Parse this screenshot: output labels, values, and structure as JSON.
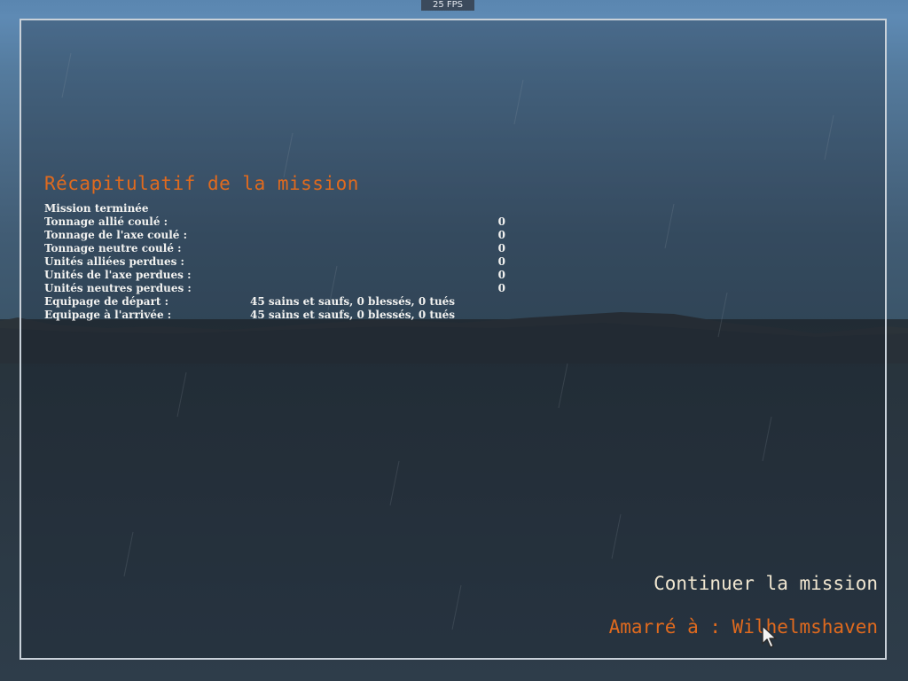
{
  "hud": {
    "fps": "25 FPS"
  },
  "summary": {
    "title": "Récapitulatif de la mission",
    "status": "Mission terminée",
    "rows": [
      {
        "label": "Tonnage allié coulé :",
        "value": "0"
      },
      {
        "label": "Tonnage de l'axe coulé :",
        "value": "0"
      },
      {
        "label": "Tonnage neutre coulé :",
        "value": "0"
      },
      {
        "label": "Unités alliées perdues :",
        "value": "0"
      },
      {
        "label": "Unités de l'axe perdues :",
        "value": "0"
      },
      {
        "label": "Unités neutres perdues :",
        "value": "0"
      }
    ],
    "crew_start": {
      "label": "Equipage de départ :",
      "value": "45 sains et saufs,  0 blessés,  0 tués"
    },
    "crew_end": {
      "label": "Equipage à l'arrivée :",
      "value": "45 sains et saufs,  0 blessés,  0 tués"
    }
  },
  "actions": {
    "continue_label": "Continuer la mission",
    "docked_label": "Amarré à : Wilhelmshaven"
  },
  "colors": {
    "accent_orange": "#e06a1e",
    "text_light": "#f2f2f0",
    "button_text": "#f0e6d0",
    "panel_border": "#c9d1d9"
  },
  "icons": {
    "cursor": "mouse-pointer-icon"
  }
}
